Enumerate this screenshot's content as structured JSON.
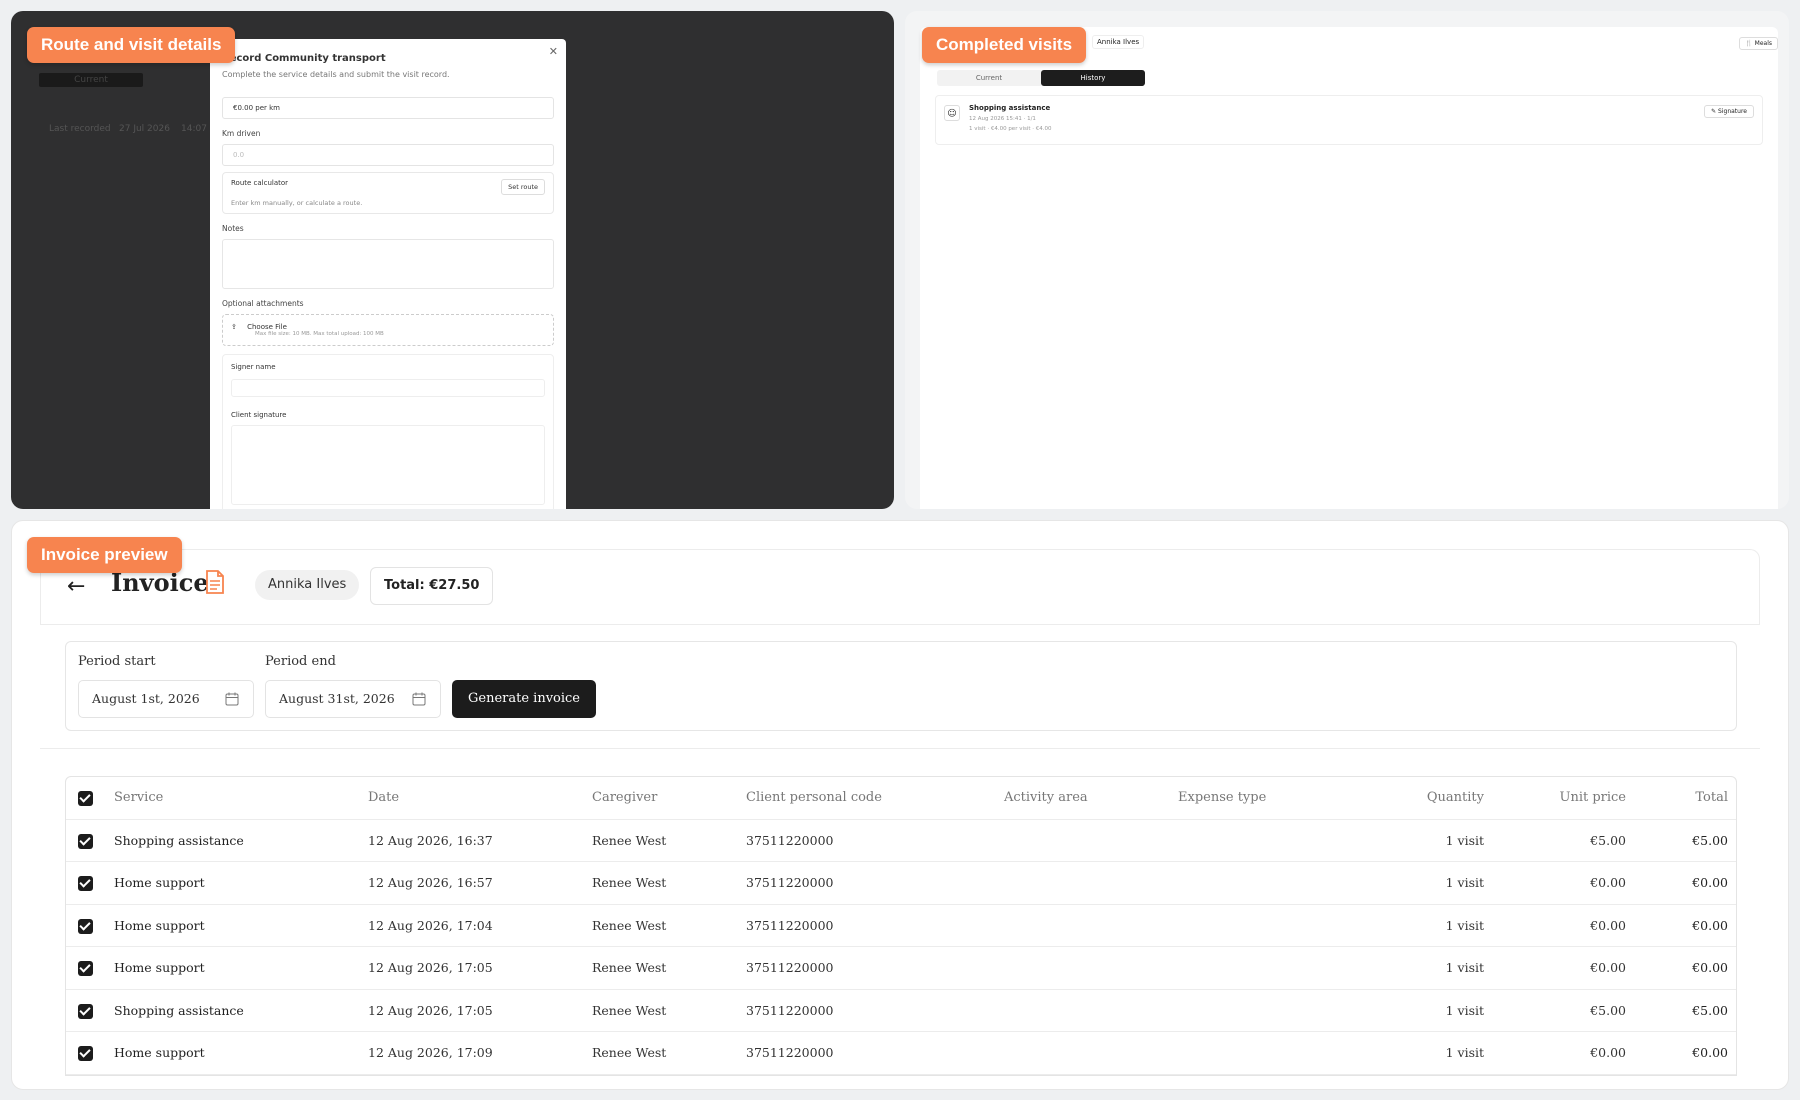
{
  "panels": {
    "route": {
      "badge": "Route and visit details"
    },
    "completed": {
      "badge": "Completed visits"
    },
    "invoice": {
      "badge": "Invoice preview"
    }
  },
  "route_modal": {
    "bg_tab": "Current",
    "bg_last_recorded": "Last recorded",
    "bg_date": "27 Jul 2026",
    "bg_time": "14:07",
    "title": "Record Community transport",
    "subtitle": "Complete the service details and submit the visit record.",
    "rate": "€0.00 per km",
    "km_label": "Km driven",
    "km_placeholder": "0.0",
    "route_calc_label": "Route calculator",
    "set_route_button": "Set route",
    "route_hint": "Enter km manually, or calculate a route.",
    "notes_label": "Notes",
    "attachments_label": "Optional attachments",
    "choose_file": "Choose File",
    "file_hint": "Max file size: 10 MB. Max total upload: 100 MB",
    "signer_label": "Signer name",
    "signature_label": "Client signature"
  },
  "completed_visits": {
    "client": "Annika Ilves",
    "meals_button": "Meals",
    "tabs": [
      "Current",
      "History"
    ],
    "visit": {
      "title": "Shopping assistance",
      "meta": "12 Aug 2026 15:41 · 1/1",
      "price": "1 visit · €4.00 per visit · €4.00",
      "signature_button": "Signature"
    }
  },
  "invoice": {
    "title": "Invoice",
    "client": "Annika Ilves",
    "total": "Total: €27.50",
    "period_start_label": "Period start",
    "period_start_value": "August 1st, 2026",
    "period_end_label": "Period end",
    "period_end_value": "August 31st, 2026",
    "generate_button": "Generate invoice",
    "columns": {
      "service": "Service",
      "date": "Date",
      "caregiver": "Caregiver",
      "personal_code": "Client personal code",
      "activity": "Activity area",
      "expense": "Expense type",
      "quantity": "Quantity",
      "unit_price": "Unit price",
      "total": "Total"
    },
    "rows": [
      {
        "service": "Shopping assistance",
        "date": "12 Aug 2026, 16:37",
        "caregiver": "Renee West",
        "code": "37511220000",
        "qty": "1 visit",
        "unit": "€5.00",
        "total": "€5.00"
      },
      {
        "service": "Home support",
        "date": "12 Aug 2026, 16:57",
        "caregiver": "Renee West",
        "code": "37511220000",
        "qty": "1 visit",
        "unit": "€0.00",
        "total": "€0.00"
      },
      {
        "service": "Home support",
        "date": "12 Aug 2026, 17:04",
        "caregiver": "Renee West",
        "code": "37511220000",
        "qty": "1 visit",
        "unit": "€0.00",
        "total": "€0.00"
      },
      {
        "service": "Home support",
        "date": "12 Aug 2026, 17:05",
        "caregiver": "Renee West",
        "code": "37511220000",
        "qty": "1 visit",
        "unit": "€0.00",
        "total": "€0.00"
      },
      {
        "service": "Shopping assistance",
        "date": "12 Aug 2026, 17:05",
        "caregiver": "Renee West",
        "code": "37511220000",
        "qty": "1 visit",
        "unit": "€5.00",
        "total": "€5.00"
      },
      {
        "service": "Home support",
        "date": "12 Aug 2026, 17:09",
        "caregiver": "Renee West",
        "code": "37511220000",
        "qty": "1 visit",
        "unit": "€0.00",
        "total": "€0.00"
      }
    ]
  },
  "colors": {
    "badge": "#f7844f",
    "primary_button": "#1c1c1c",
    "overlay": "#2f2f30"
  }
}
